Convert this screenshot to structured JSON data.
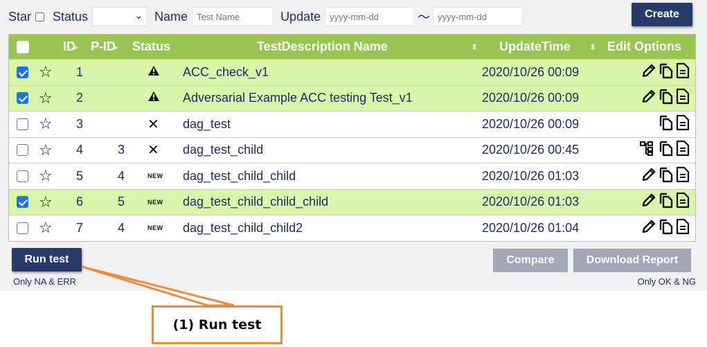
{
  "filters": {
    "star_label": "Star",
    "status_label": "Status",
    "name_label": "Name",
    "name_placeholder": "Test Name",
    "update_label": "Update",
    "date_from_placeholder": "yyyy-mm-dd",
    "range_sep": "～",
    "date_to_placeholder": "yyyy-mm-dd",
    "create_label": "Create"
  },
  "table": {
    "headers": {
      "id": "ID",
      "pid": "P-ID",
      "status": "Status",
      "name": "TestDescription Name",
      "update": "UpdateTime",
      "edit": "Edit Options"
    },
    "rows": [
      {
        "checked": true,
        "id": "1",
        "pid": "",
        "status": "warning",
        "name": "ACC_check_v1",
        "time": "2020/10/26 00:09",
        "icons": [
          "pencil-icon",
          "copy-icon",
          "document-icon"
        ]
      },
      {
        "checked": true,
        "id": "2",
        "pid": "",
        "status": "warning",
        "name": "Adversarial Example ACC testing Test_v1",
        "time": "2020/10/26 00:09",
        "icons": [
          "pencil-icon",
          "copy-icon",
          "document-icon"
        ]
      },
      {
        "checked": false,
        "id": "3",
        "pid": "",
        "status": "x",
        "name": "dag_test",
        "time": "2020/10/26 00:09",
        "icons": [
          "copy-icon",
          "document-icon"
        ]
      },
      {
        "checked": false,
        "id": "4",
        "pid": "3",
        "status": "x",
        "name": "dag_test_child",
        "time": "2020/10/26 00:45",
        "icons": [
          "tree-icon",
          "copy-icon",
          "document-icon"
        ]
      },
      {
        "checked": false,
        "id": "5",
        "pid": "4",
        "status": "new",
        "name": "dag_test_child_child",
        "time": "2020/10/26 01:03",
        "icons": [
          "pencil-icon",
          "copy-icon",
          "document-icon"
        ]
      },
      {
        "checked": true,
        "id": "6",
        "pid": "5",
        "status": "new",
        "name": "dag_test_child_child_child",
        "time": "2020/10/26 01:03",
        "icons": [
          "pencil-icon",
          "copy-icon",
          "document-icon"
        ]
      },
      {
        "checked": false,
        "id": "7",
        "pid": "4",
        "status": "new",
        "name": "dag_test_child_child2",
        "time": "2020/10/26 01:04",
        "icons": [
          "pencil-icon",
          "copy-icon",
          "document-icon"
        ]
      }
    ],
    "new_badge": "NEW"
  },
  "actions": {
    "run_label": "Run test",
    "run_note": "Only NA & ERR",
    "compare_label": "Compare",
    "report_label": "Download Report",
    "report_note": "Only OK & NG"
  },
  "callout": {
    "text": "(1) Run test"
  },
  "colors": {
    "header_green": "#99c552",
    "row_highlight": "#d8f7a8",
    "primary_button": "#273b6a",
    "disabled_button": "#a4a7ba",
    "callout_orange": "#ef8a3a"
  }
}
